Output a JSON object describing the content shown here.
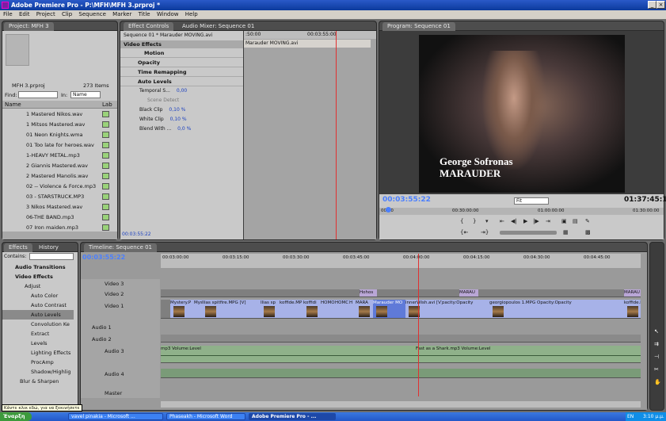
{
  "window": {
    "title": "Adobe Premiere Pro - P:\\MFH\\MFH 3.prproj *"
  },
  "menu": [
    "File",
    "Edit",
    "Project",
    "Clip",
    "Sequence",
    "Marker",
    "Title",
    "Window",
    "Help"
  ],
  "project": {
    "tab": "Project: MFH 3",
    "name": "MFH 3.prproj",
    "count": "273 Items",
    "find_label": "Find:",
    "in_label": "In:",
    "in_value": "Name",
    "col_name": "Name",
    "col_label": "Lab",
    "items": [
      "1 Mastered Nikos.wav",
      "1 Mitsos Mastered.wav",
      "01 Neon Knights.wma",
      "01 Too late for heroes.wav",
      "1-HEAVY METAL.mp3",
      "2 Giannis Mastered.wav",
      "2 Mastered Manolis.wav",
      "02 -- Violence & Force.mp3",
      "03 - STARSTRUCK.MP3",
      "3 Nikos Mastered.wav",
      "06-THE BAND.mp3",
      "07 Iron maiden.mp3"
    ]
  },
  "effect_controls": {
    "tab1": "Effect Controls",
    "tab2": "Audio Mixer: Sequence 01",
    "sequence": "Sequence 01 * Marauder MOVING.avi",
    "clip_name": "Marauder MOVING.avi",
    "tc_start": ":50:00",
    "tc_end": "00:03:55:00",
    "video_effects": "Video Effects",
    "motion": "Motion",
    "opacity": "Opacity",
    "time_remap": "Time Remapping",
    "auto_levels": "Auto Levels",
    "params": [
      {
        "name": "Temporal S...",
        "value": "0,00"
      },
      {
        "name": "Scene Detect",
        "value": ""
      },
      {
        "name": "Black Clip",
        "value": "0,10 %"
      },
      {
        "name": "White Clip",
        "value": "0,10 %"
      },
      {
        "name": "Blend With ...",
        "value": "0,0 %"
      }
    ],
    "footer_tc": "00:03:55:22"
  },
  "program": {
    "tab": "Program: Sequence 01",
    "caption_line1": "George Sofronas",
    "caption_line2": "MARAUDER",
    "tc": "00:03:55:22",
    "fit": "Fit",
    "duration": "01:37:45:19",
    "ruler": [
      "00:00",
      "00:30:00:00",
      "01:00:00:00",
      "01:30:00:00"
    ]
  },
  "effects": {
    "tab1": "Effects",
    "tab2": "History",
    "contains": "Contains:",
    "tree": [
      "Audio Transitions",
      "Video Effects",
      "Adjust",
      "Auto Color",
      "Auto Contrast",
      "Auto Levels",
      "Convolution Ke",
      "Extract",
      "Levels",
      "Lighting Effects",
      "ProcAmp",
      "Shadow/Highlig",
      "Blur & Sharpen"
    ]
  },
  "timeline": {
    "tab": "Timeline: Sequence 01",
    "tc": "00:03:55:22",
    "ruler": [
      "00:03:00:00",
      "00:03:15:00",
      "00:03:30:00",
      "00:03:45:00",
      "00:04:00:00",
      "00:04:15:00",
      "00:04:30:00",
      "00:04:45:00"
    ],
    "tracks": [
      "Video 3",
      "Video 2",
      "Video 1",
      "Audio 1",
      "Audio 2",
      "Audio 3",
      "Audio 4",
      "Master"
    ],
    "v2_clips": [
      "Hohos",
      "MARAU",
      "MARAU"
    ],
    "v1_clips": [
      "Mystery.P",
      "Mys",
      "Ilias spitfire.MPG [V]",
      "Ilias sp",
      "koffide.MP",
      "koffidi",
      "HOMO",
      "HOMC",
      "H",
      "MARA",
      "Marauder MO",
      "innerWish.avi [V]",
      "pacity:Opacity",
      "georgiopoulos 1.MPG [V]",
      "Opacity:Opacity",
      "koffide.MP"
    ],
    "a3_label": "mp3  Volume:Level",
    "a3_label2": "Fast as a Shark.mp3  Volume:Level"
  },
  "status": "Κάντε κλικ εδώ, για να ξεκινήσετε",
  "taskbar": {
    "start": "Έναρξη",
    "tasks": [
      "vavel pinakia - Microsoft ...",
      "Phaseakh - Microsoft Word",
      "Adobe Premiere Pro - ..."
    ],
    "lang": "EN",
    "clock": "3:10 μ.μ."
  },
  "colors": {
    "accent": "#4a7fff",
    "clip_blue": "#a7b2e8",
    "clip_purple": "#b9a6d6",
    "clip_audio": "#8fb18a",
    "playhead": "#e03030"
  }
}
